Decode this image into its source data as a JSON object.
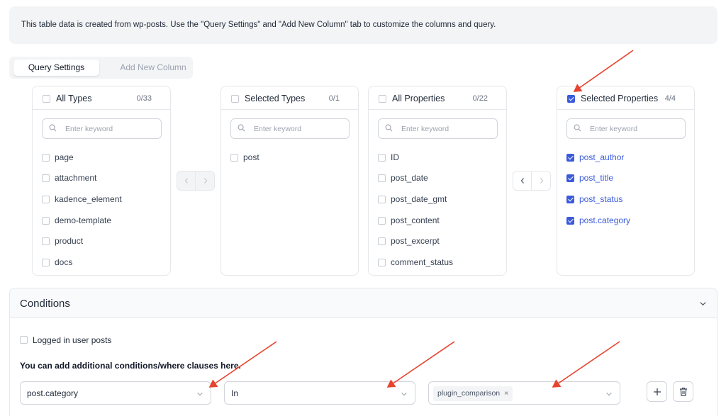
{
  "notice": "This table data is created from wp-posts. Use the \"Query Settings\" and \"Add New Column\" tab to customize the columns and query.",
  "tabs": {
    "query_settings": "Query Settings",
    "add_new_column": "Add New Column"
  },
  "types": {
    "all": {
      "title": "All Types",
      "count": "0/33",
      "placeholder": "Enter keyword",
      "items": [
        "page",
        "attachment",
        "kadence_element",
        "demo-template",
        "product",
        "docs"
      ]
    },
    "selected": {
      "title": "Selected Types",
      "count": "0/1",
      "placeholder": "Enter keyword",
      "items": [
        "post"
      ]
    }
  },
  "properties": {
    "all": {
      "title": "All Properties",
      "count": "0/22",
      "placeholder": "Enter keyword",
      "items": [
        "ID",
        "post_date",
        "post_date_gmt",
        "post_content",
        "post_excerpt",
        "comment_status"
      ]
    },
    "selected": {
      "title": "Selected Properties",
      "count": "4/4",
      "placeholder": "Enter keyword",
      "items": [
        "post_author",
        "post_title",
        "post_status",
        "post.category"
      ]
    }
  },
  "conditions": {
    "title": "Conditions",
    "logged_in_label": "Logged in user posts",
    "info": "You can add additional conditions/where clauses here.",
    "field_value": "post.category",
    "operator_value": "In",
    "value_tag": "plugin_comparison"
  },
  "colors": {
    "accent": "#3b5bdb",
    "annotation_arrow": "#e8432e"
  }
}
